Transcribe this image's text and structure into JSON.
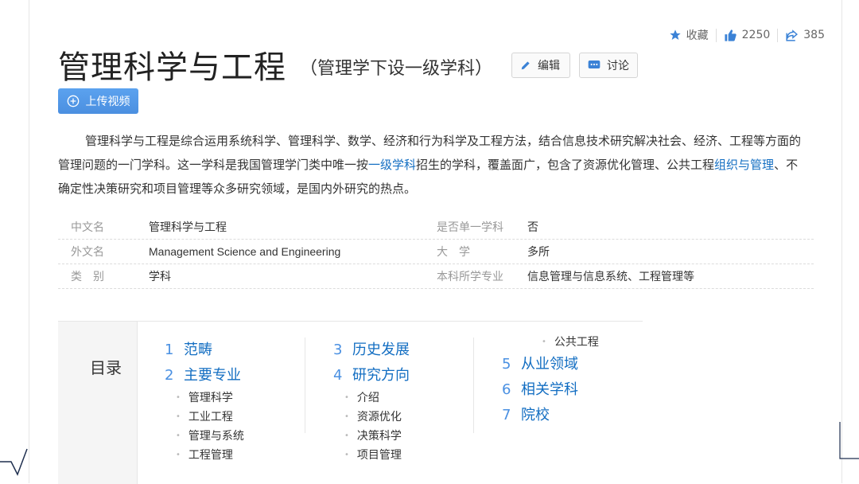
{
  "actions": {
    "favorite": "收藏",
    "likes": "2250",
    "shares": "385"
  },
  "title": "管理科学与工程",
  "subtitle": "（管理学下设一级学科）",
  "buttons": {
    "edit": "编辑",
    "discuss": "讨论",
    "upload": "上传视频"
  },
  "intro": {
    "part1": "管理科学与工程是综合运用系统科学、管理科学、数学、经济和行为科学及工程方法，结合信息技术研究解决社会、经济、工程等方面的管理问题的一门学科。这一学科是我国管理学门类中唯一按",
    "link1": "一级学科",
    "part2": "招生的学科，覆盖面广，包含了资源优化管理、公共工程",
    "link2": "组织与管理",
    "part3": "、不确定性决策研究和项目管理等众多研究领域，是国内外研究的热点。"
  },
  "info": [
    {
      "k1": "中文名",
      "v1": "管理科学与工程",
      "k2": "是否单一学科",
      "v2": "否"
    },
    {
      "k1": "外文名",
      "v1": "Management Science and Engineering",
      "k2": "大　学",
      "v2": "多所"
    },
    {
      "k1": "类　别",
      "v1": "学科",
      "k2": "本科所学专业",
      "v2": "信息管理与信息系统、工程管理等"
    }
  ],
  "catalog": {
    "label": "目录",
    "items": [
      {
        "num": "1",
        "title": "范畴"
      },
      {
        "num": "2",
        "title": "主要专业",
        "subs": [
          "管理科学",
          "工业工程",
          "管理与系统",
          "工程管理"
        ]
      },
      {
        "num": "3",
        "title": "历史发展"
      },
      {
        "num": "4",
        "title": "研究方向",
        "subs": [
          "介绍",
          "资源优化",
          "决策科学",
          "项目管理",
          "公共工程"
        ]
      },
      {
        "num": "5",
        "title": "从业领域"
      },
      {
        "num": "6",
        "title": "相关学科"
      },
      {
        "num": "7",
        "title": "院校"
      }
    ]
  }
}
